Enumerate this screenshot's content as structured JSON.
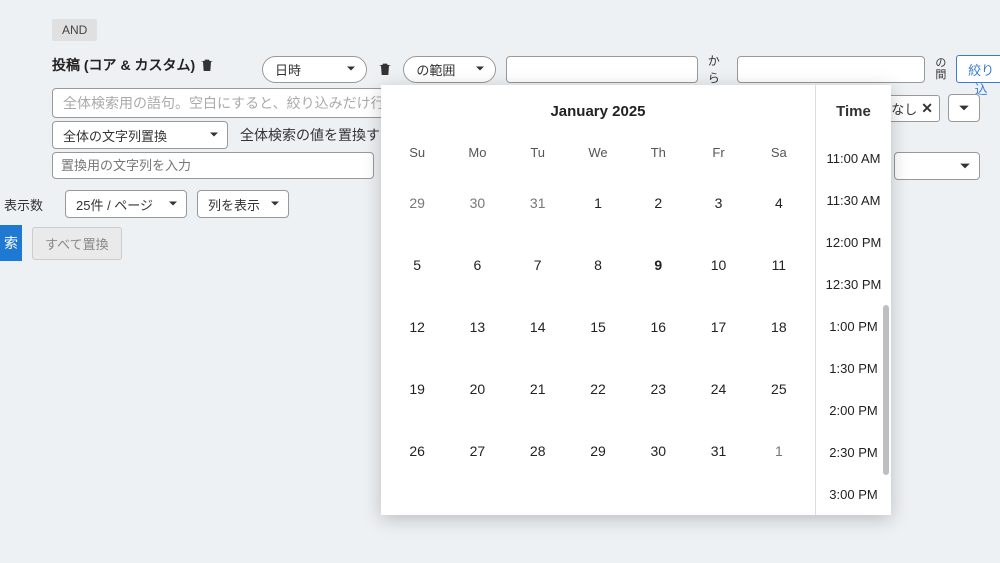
{
  "and_badge": "AND",
  "post_label": "投稿 (コア & カスタム)",
  "filter": {
    "field": "日時",
    "operator": "の範囲",
    "from_value": "",
    "to_value": "",
    "from_label": "から",
    "between_label": "の\n間"
  },
  "narrow_button": "絞り込",
  "global_search_placeholder": "全体検索用の語句。空白にすると、絞り込みだけ行い",
  "replace_mode": "全体の文字列置換",
  "replace_hint": "全体検索の値を置換す",
  "no_replace_chip": "いなし",
  "replace_value_placeholder": "置換用の文字列を入力",
  "rows_label": "表示数",
  "rows_per_page": "25件 / ページ",
  "columns_toggle": "列を表示",
  "search_button": "索",
  "replace_all_button": "すべて置換",
  "datepicker": {
    "month_title": "January 2025",
    "time_title": "Time",
    "dow": [
      "Su",
      "Mo",
      "Tu",
      "We",
      "Th",
      "Fr",
      "Sa"
    ],
    "today": 9,
    "weeks": [
      [
        {
          "d": 29,
          "o": true
        },
        {
          "d": 30,
          "o": true
        },
        {
          "d": 31,
          "o": true
        },
        {
          "d": 1
        },
        {
          "d": 2
        },
        {
          "d": 3
        },
        {
          "d": 4
        }
      ],
      [
        {
          "d": 5
        },
        {
          "d": 6
        },
        {
          "d": 7
        },
        {
          "d": 8
        },
        {
          "d": 9,
          "today": true
        },
        {
          "d": 10
        },
        {
          "d": 11
        }
      ],
      [
        {
          "d": 12
        },
        {
          "d": 13
        },
        {
          "d": 14
        },
        {
          "d": 15
        },
        {
          "d": 16
        },
        {
          "d": 17
        },
        {
          "d": 18
        }
      ],
      [
        {
          "d": 19
        },
        {
          "d": 20
        },
        {
          "d": 21
        },
        {
          "d": 22
        },
        {
          "d": 23
        },
        {
          "d": 24
        },
        {
          "d": 25
        }
      ],
      [
        {
          "d": 26
        },
        {
          "d": 27
        },
        {
          "d": 28
        },
        {
          "d": 29
        },
        {
          "d": 30
        },
        {
          "d": 31
        },
        {
          "d": 1,
          "o": true
        }
      ]
    ],
    "times": [
      "11:00 AM",
      "11:30 AM",
      "12:00 PM",
      "12:30 PM",
      "1:00 PM",
      "1:30 PM",
      "2:00 PM",
      "2:30 PM",
      "3:00 PM"
    ]
  }
}
